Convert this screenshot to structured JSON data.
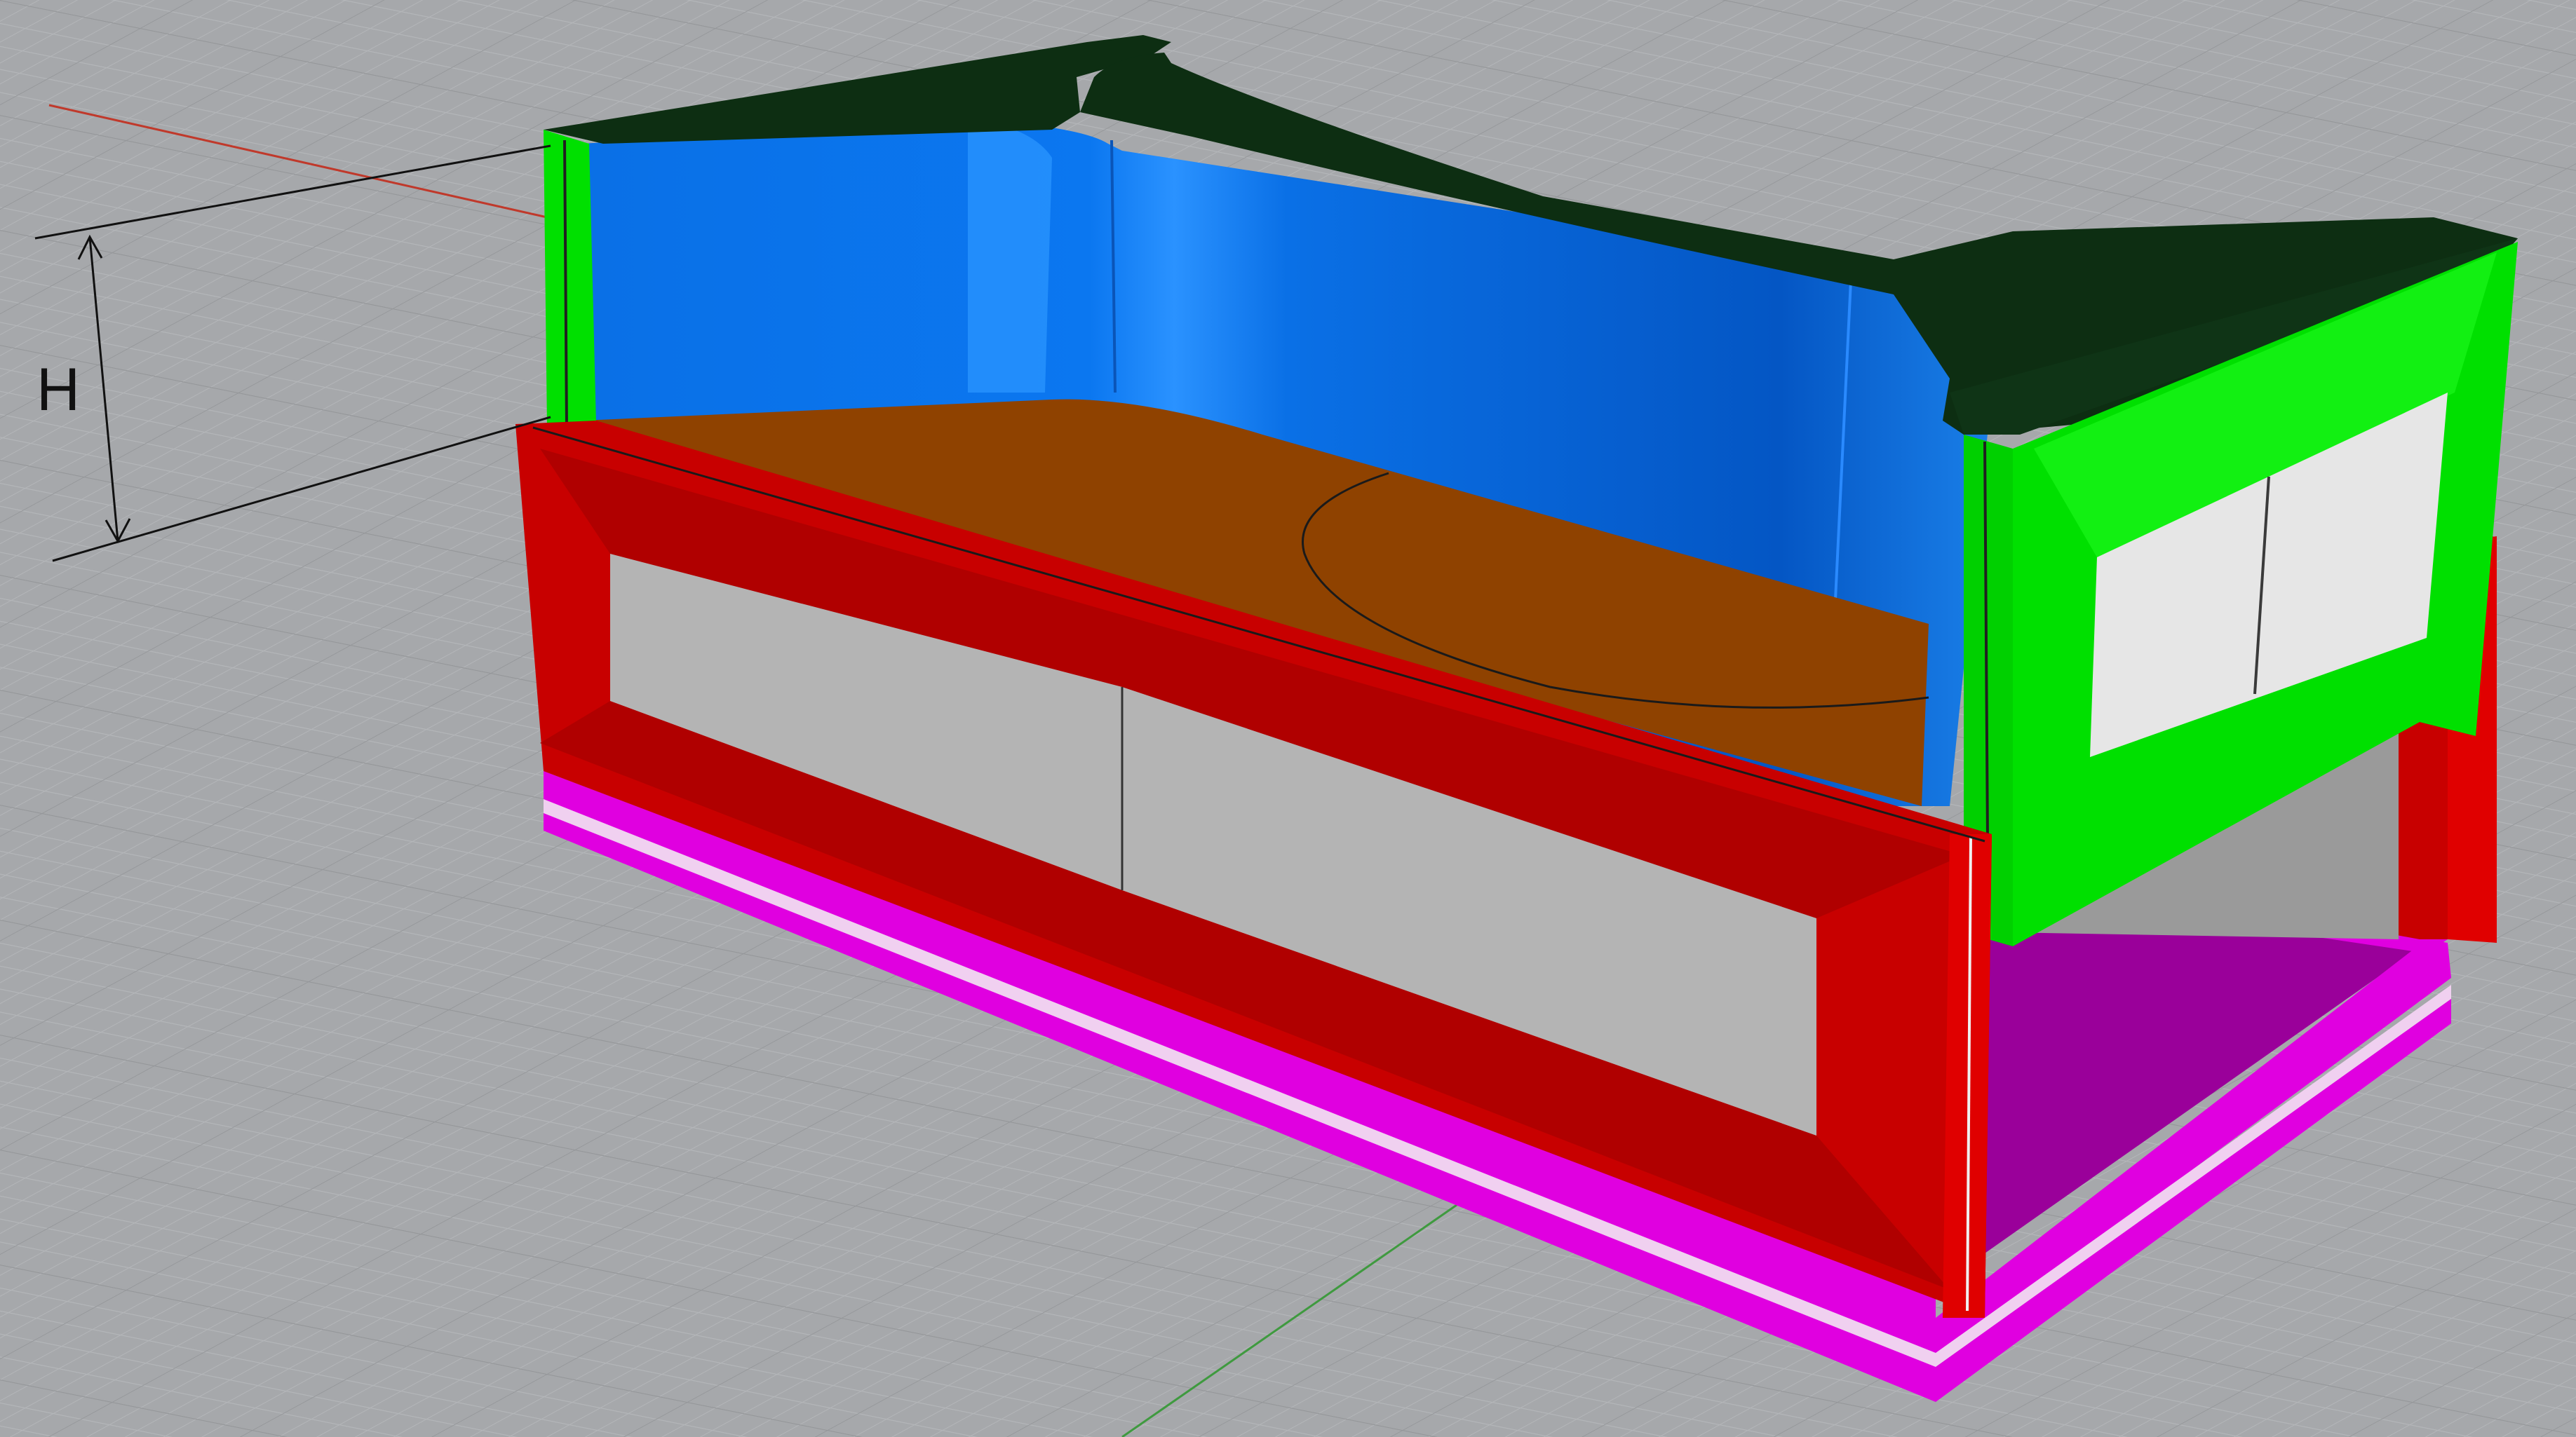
{
  "viewport": {
    "background_color": "#a6a8ab",
    "grid_minor_color": "#b4b6b9",
    "grid_major_color": "#8e9093",
    "x_axis_color": "#c0392b",
    "y_axis_color": "#3f9a3f"
  },
  "model": {
    "parts": [
      {
        "name": "top-frame",
        "color": "#0d2e12"
      },
      {
        "name": "back-curved-wall",
        "color": "#0a6fe0"
      },
      {
        "name": "floor-plate",
        "color": "#8f4200"
      },
      {
        "name": "front-panel",
        "color": "#c80000"
      },
      {
        "name": "side-panel",
        "color": "#00e000"
      },
      {
        "name": "base-frame",
        "color": "#e000e0"
      },
      {
        "name": "window-infill",
        "color": "#b4b4b4"
      }
    ]
  },
  "dimension": {
    "label": "H"
  }
}
